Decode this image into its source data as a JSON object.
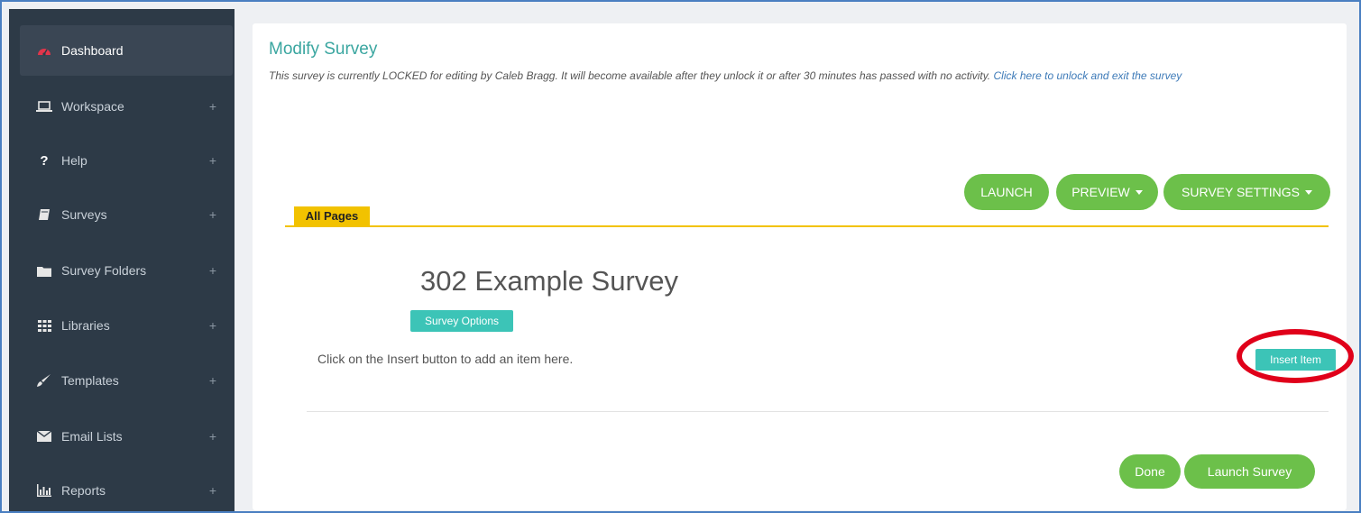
{
  "sidebar": {
    "items": [
      {
        "label": "Dashboard",
        "icon": "dashboard-icon",
        "plus": ""
      },
      {
        "label": "Workspace",
        "icon": "laptop-icon",
        "plus": "+"
      },
      {
        "label": "Help",
        "icon": "question-icon",
        "plus": "+"
      },
      {
        "label": "Surveys",
        "icon": "book-icon",
        "plus": "+"
      },
      {
        "label": "Survey Folders",
        "icon": "folder-icon",
        "plus": "+"
      },
      {
        "label": "Libraries",
        "icon": "grid-icon",
        "plus": "+"
      },
      {
        "label": "Templates",
        "icon": "brush-icon",
        "plus": "+"
      },
      {
        "label": "Email Lists",
        "icon": "envelope-icon",
        "plus": "+"
      },
      {
        "label": "Reports",
        "icon": "bar-chart-icon",
        "plus": "+"
      }
    ]
  },
  "main": {
    "title": "Modify Survey",
    "lock_message": "This survey is currently LOCKED for editing by Caleb Bragg. It will become available after they unlock it or after 30 minutes has passed with no activity. ",
    "unlock_link": "Click here to unlock and exit the survey",
    "toolbar": {
      "launch": "LAUNCH",
      "preview": "PREVIEW",
      "settings": "SURVEY SETTINGS"
    },
    "tab_label": "All Pages",
    "survey_title": "302 Example Survey",
    "survey_options": "Survey Options",
    "insert_hint": "Click on the Insert button to add an item here.",
    "insert_item": "Insert Item",
    "done": "Done",
    "launch_survey": "Launch Survey"
  },
  "colors": {
    "sidebar_bg": "#2d3a47",
    "accent_teal": "#3cc4b7",
    "button_green": "#6cc04a",
    "tab_yellow": "#f2c200",
    "highlight_red": "#e0001a"
  }
}
